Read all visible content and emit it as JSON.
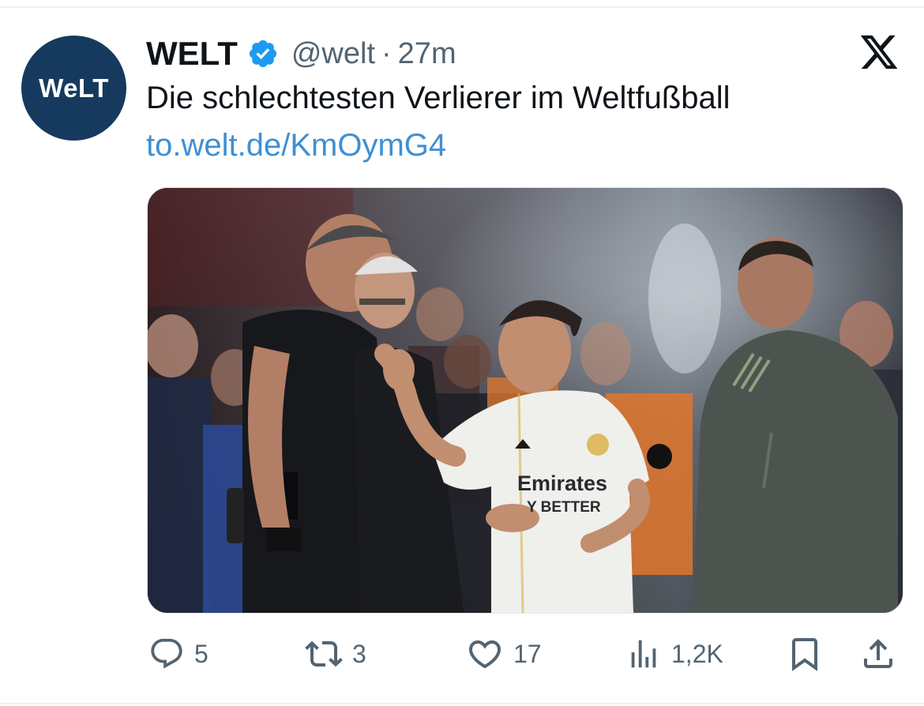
{
  "tweet": {
    "avatar_text": "WeLT",
    "author_name": "WELT",
    "handle": "@welt",
    "separator": "·",
    "time": "27m",
    "text": "Die schlechtesten Verlierer im Weltfußball",
    "link": "to.welt.de/KmOymG4",
    "media_overlay": {
      "shirt_sponsor_line1": "Emirates",
      "shirt_sponsor_line2": "Y BETTER"
    }
  },
  "actions": {
    "replies": "5",
    "retweets": "3",
    "likes": "17",
    "views": "1,2K"
  },
  "colors": {
    "avatar_bg": "#163a5e",
    "verified": "#1d9bf0",
    "link": "#3f8fd3",
    "secondary_text": "#536471"
  },
  "icons": [
    "verified-badge-icon",
    "x-logo-icon",
    "reply-icon",
    "retweet-icon",
    "like-icon",
    "views-icon",
    "bookmark-icon",
    "share-icon"
  ]
}
